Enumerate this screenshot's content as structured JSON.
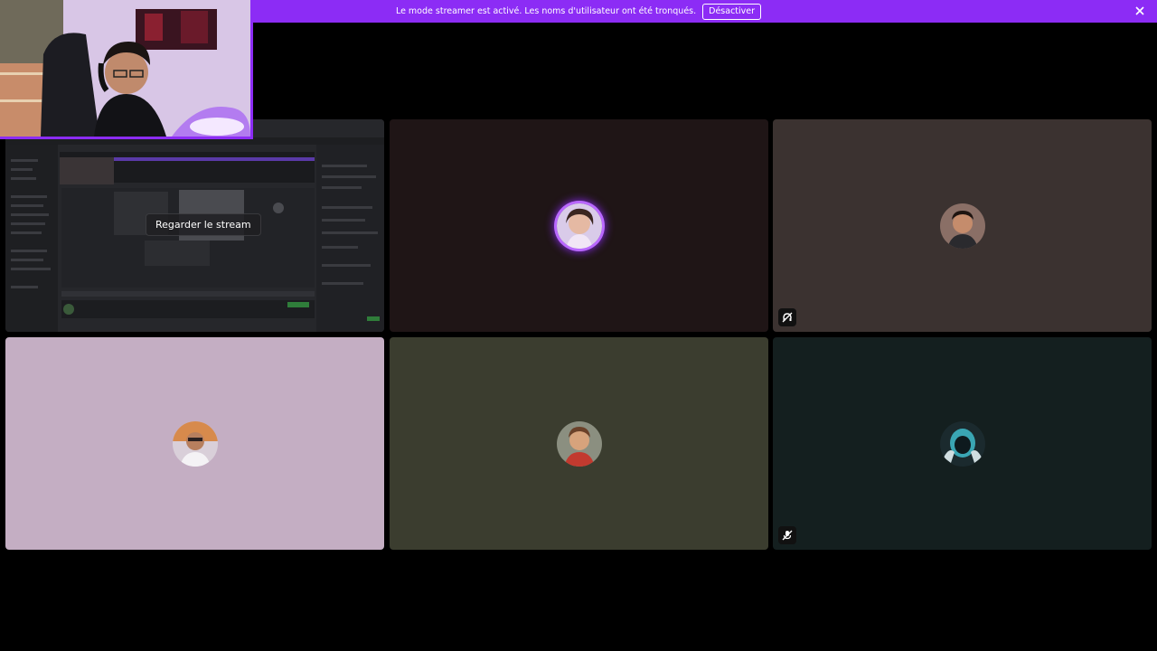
{
  "banner": {
    "message": "Le mode streamer est activé. Les noms d'utilisateur ont été tronqués.",
    "disable_label": "Désactiver",
    "color": "#8c2cf5"
  },
  "stream_tile": {
    "watch_label": "Regarder le stream"
  },
  "tiles": [
    {
      "id": "stream",
      "background": "#242529"
    },
    {
      "id": "participant-2",
      "background": "#1f1516",
      "speaking": true
    },
    {
      "id": "participant-3",
      "background": "#3b3230",
      "status_icon": "deafened-icon"
    },
    {
      "id": "participant-4",
      "background": "#c4aec3"
    },
    {
      "id": "participant-5",
      "background": "#3b3d2f"
    },
    {
      "id": "participant-6",
      "background": "#141f1f",
      "status_icon": "muted-icon"
    }
  ]
}
